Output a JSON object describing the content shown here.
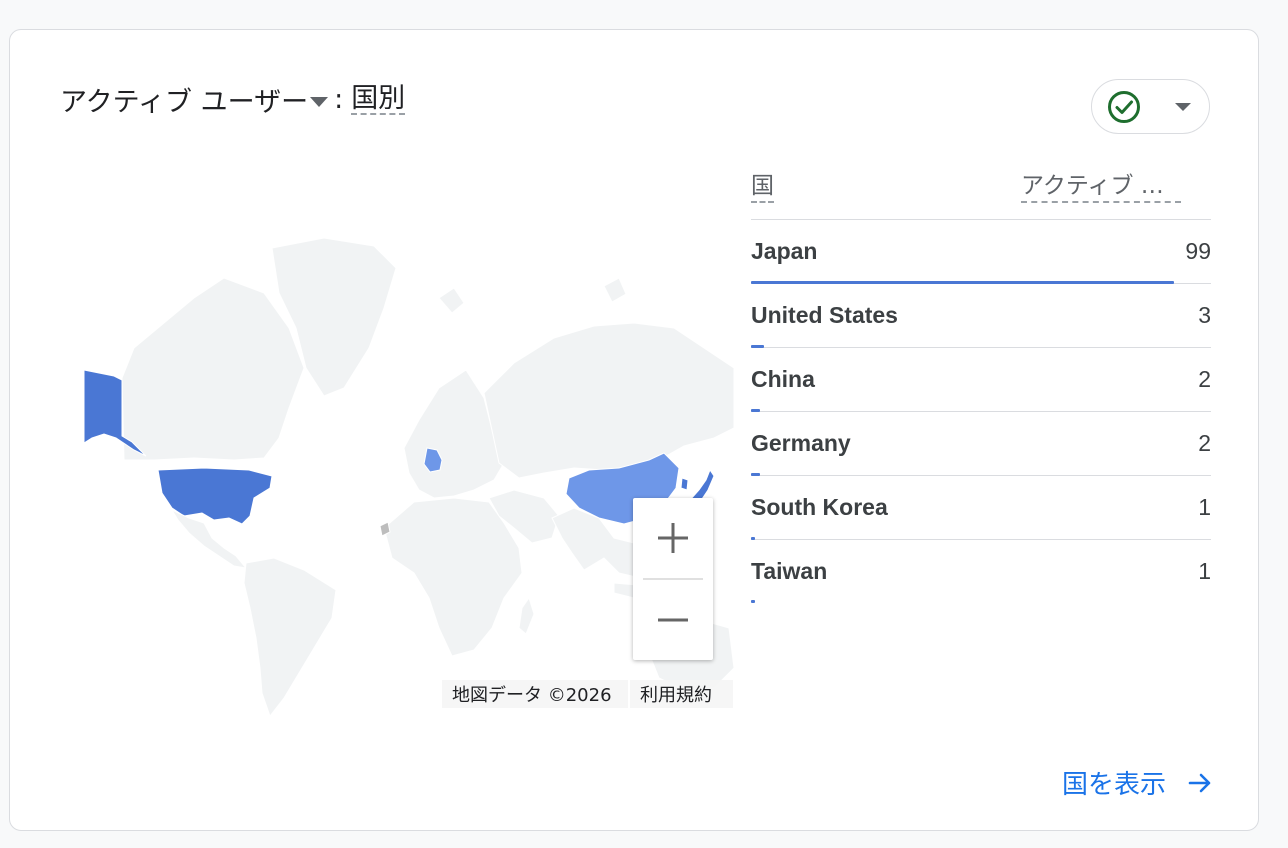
{
  "card": {
    "title_metric": "アクティブ ユーザー",
    "title_colon": ":",
    "title_dimension": "国別"
  },
  "status_button": {
    "icon": "check-circle-icon",
    "color": "#1e8e3e"
  },
  "table": {
    "col_country": "国",
    "col_metric": "アクティブ ユ...",
    "max_value": 99,
    "rows": [
      {
        "country": "Japan",
        "value": "99",
        "ratio": 1.0
      },
      {
        "country": "United States",
        "value": "3",
        "ratio": 0.0303
      },
      {
        "country": "China",
        "value": "2",
        "ratio": 0.0202
      },
      {
        "country": "Germany",
        "value": "2",
        "ratio": 0.0202
      },
      {
        "country": "South Korea",
        "value": "1",
        "ratio": 0.0101
      },
      {
        "country": "Taiwan",
        "value": "1",
        "ratio": 0.0101
      }
    ]
  },
  "map": {
    "attribution": "地図データ ©2026",
    "terms": "利用規約",
    "zoom_in": "zoom-in-icon",
    "zoom_out": "zoom-out-icon",
    "colors": {
      "land": "#f1f3f4",
      "high": "#4a77d4",
      "mid": "#6e97e8",
      "border": "#ffffff",
      "nodata": "#bdbdbd"
    }
  },
  "footer": {
    "view_link": "国を表示"
  },
  "colors": {
    "accent": "#1a73e8",
    "bar": "#4a77d4"
  }
}
